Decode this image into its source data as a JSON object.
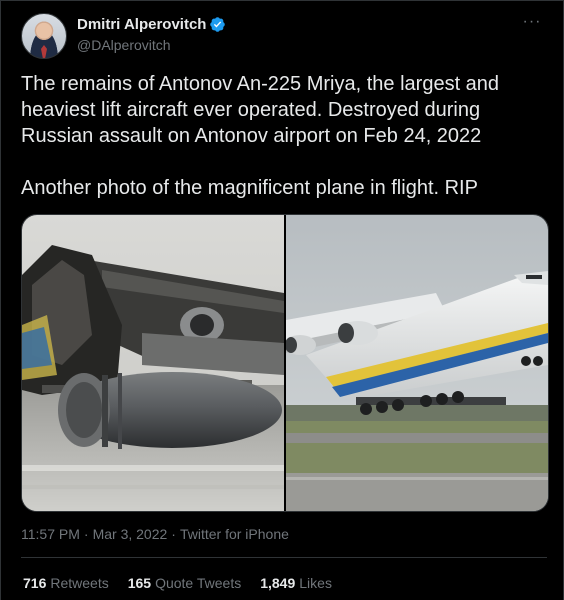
{
  "author": {
    "name": "Dmitri Alperovitch",
    "handle": "@DAlperovitch",
    "avatar_icon": "profile-photo",
    "verified_icon": "verified-badge-icon"
  },
  "more_icon": "more-options-icon",
  "tweet": {
    "paragraph_1": "The remains of Antonov An-225 Mriya, the largest and heaviest lift aircraft ever operated. Destroyed during Russian assault on Antonov airport on Feb 24, 2022",
    "paragraph_2": "Another photo of the magnificent plane in flight. RIP"
  },
  "media": {
    "photo_left": "destroyed-aircraft-photo",
    "photo_right": "aircraft-in-flight-photo"
  },
  "meta": {
    "time": "11:57 PM",
    "separator_1": "·",
    "date": "Mar 3, 2022",
    "separator_2": "·",
    "source": "Twitter for iPhone"
  },
  "stats": {
    "retweets_count": "716",
    "retweets_label": "Retweets",
    "quote_count": "165",
    "quote_label": "Quote Tweets",
    "likes_count": "1,849",
    "likes_label": "Likes"
  },
  "colors": {
    "background": "#000000",
    "text_primary": "#e7e9ea",
    "text_secondary": "#71767b",
    "verified": "#1d9bf0",
    "border": "#2f3336"
  }
}
